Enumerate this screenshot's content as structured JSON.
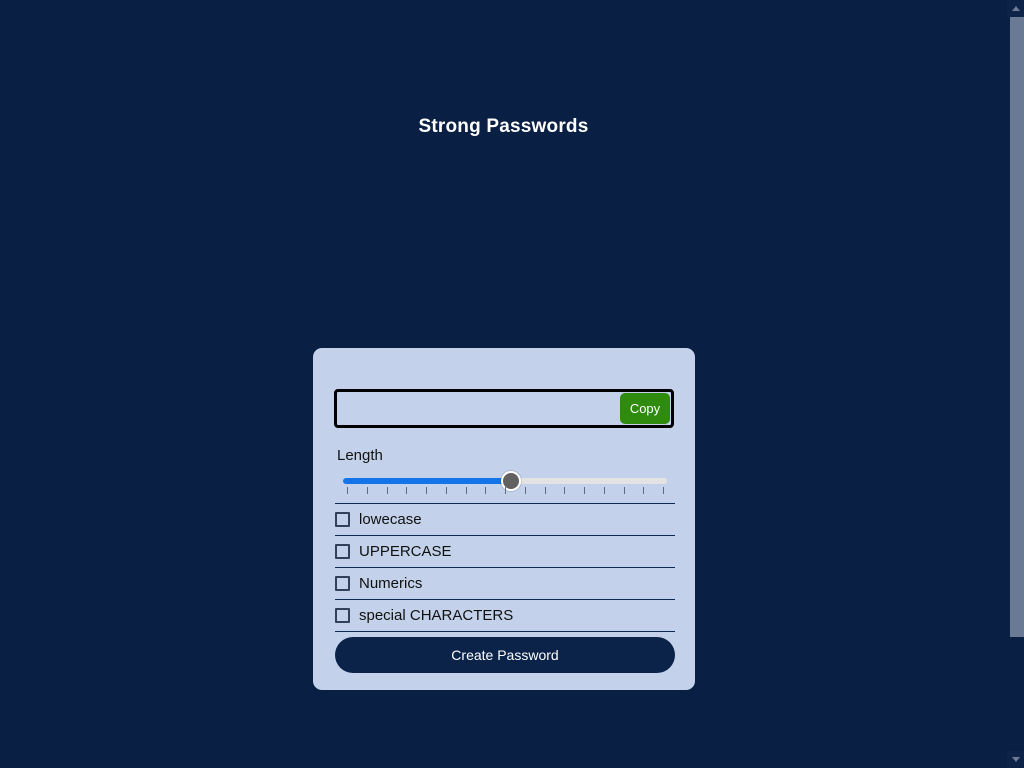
{
  "page": {
    "title": "Strong Passwords",
    "background_color": "#0a1f44",
    "card_color": "#c3d2ea"
  },
  "card": {
    "password_field": {
      "value": "",
      "placeholder": ""
    },
    "copy_button": {
      "label": "Copy",
      "color": "#2e8b0d"
    },
    "length": {
      "label": "Length",
      "value": 16,
      "min": 1,
      "max": 30,
      "fill_percent": 52,
      "tick_count": 17,
      "track_color": "#e3e3e3",
      "fill_color": "#1473e6",
      "thumb_color": "#616161"
    },
    "options": [
      {
        "label": "lowecase",
        "checked": false
      },
      {
        "label": "UPPERCASE",
        "checked": false
      },
      {
        "label": "Numerics",
        "checked": false
      },
      {
        "label": "special CHARACTERS",
        "checked": false
      }
    ],
    "create_button": {
      "label": "Create Password",
      "color": "#0b2249"
    }
  },
  "scrollbar": {
    "up_arrow_icon": "chevron-up-icon",
    "down_arrow_icon": "chevron-down-icon"
  }
}
